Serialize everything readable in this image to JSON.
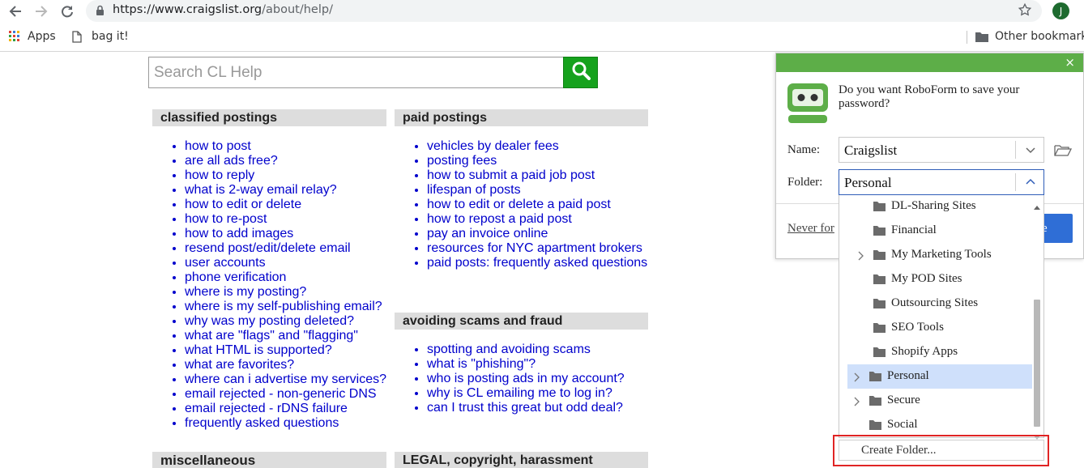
{
  "browser": {
    "url_host": "https://www.craigslist.org",
    "url_path": "/about/help/",
    "profile_initial": "J",
    "icons": [
      "back-icon",
      "forward-icon",
      "reload-icon",
      "lock-icon",
      "star-icon"
    ]
  },
  "bookmarks": {
    "apps_label": "Apps",
    "bag_label": "bag it!",
    "other_label": "Other bookmarks"
  },
  "search": {
    "placeholder": "Search CL Help",
    "button_icon": "search-icon"
  },
  "sections": {
    "classified": {
      "heading": "classified postings",
      "links": [
        "how to post",
        "are all ads free?",
        "how to reply",
        "what is 2-way email relay?",
        "how to edit or delete",
        "how to re-post",
        "how to add images",
        "resend post/edit/delete email",
        "user accounts",
        "phone verification",
        "where is my posting?",
        "where is my self-publishing email?",
        "why was my posting deleted?",
        "what are \"flags\" and \"flagging\"",
        "what HTML is supported?",
        "what are favorites?",
        "where can i advertise my services?",
        "email rejected - non-generic DNS",
        "email rejected - rDNS failure",
        "frequently asked questions"
      ]
    },
    "paid": {
      "heading": "paid postings",
      "links": [
        "vehicles by dealer fees",
        "posting fees",
        "how to submit a paid job post",
        "lifespan of posts",
        "how to edit or delete a paid post",
        "how to repost a paid post",
        "pay an invoice online",
        "resources for NYC apartment brokers",
        "paid posts: frequently asked questions"
      ]
    },
    "scams": {
      "heading": "avoiding scams and fraud",
      "links": [
        "spotting and avoiding scams",
        "what is \"phishing\"?",
        "who is posting ads in my account?",
        "why is CL emailing me to log in?",
        "can I trust this great but odd deal?"
      ]
    },
    "misc": {
      "heading": "miscellaneous"
    },
    "legal": {
      "heading": "LEGAL, copyright, harassment"
    }
  },
  "roboform": {
    "question": "Do you want RoboForm to save your password?",
    "name_label": "Name:",
    "name_value": "Craigslist",
    "folder_label": "Folder:",
    "folder_value": "Personal",
    "never_label": "Never for",
    "save_label": "e",
    "close_symbol": "×",
    "accent_color": "#5dae48",
    "folders": [
      {
        "label": "DL-Sharing Sites",
        "expandable": false,
        "selected": false
      },
      {
        "label": "Financial",
        "expandable": false,
        "selected": false
      },
      {
        "label": "My Marketing Tools",
        "expandable": true,
        "selected": false
      },
      {
        "label": "My POD Sites",
        "expandable": false,
        "selected": false
      },
      {
        "label": "Outsourcing Sites",
        "expandable": false,
        "selected": false
      },
      {
        "label": "SEO Tools",
        "expandable": false,
        "selected": false
      },
      {
        "label": "Shopify Apps",
        "expandable": false,
        "selected": false
      },
      {
        "label": "Personal",
        "expandable": true,
        "selected": true
      },
      {
        "label": "Secure",
        "expandable": true,
        "selected": false
      },
      {
        "label": "Social",
        "expandable": false,
        "selected": false
      }
    ],
    "create_folder_label": "Create Folder..."
  }
}
